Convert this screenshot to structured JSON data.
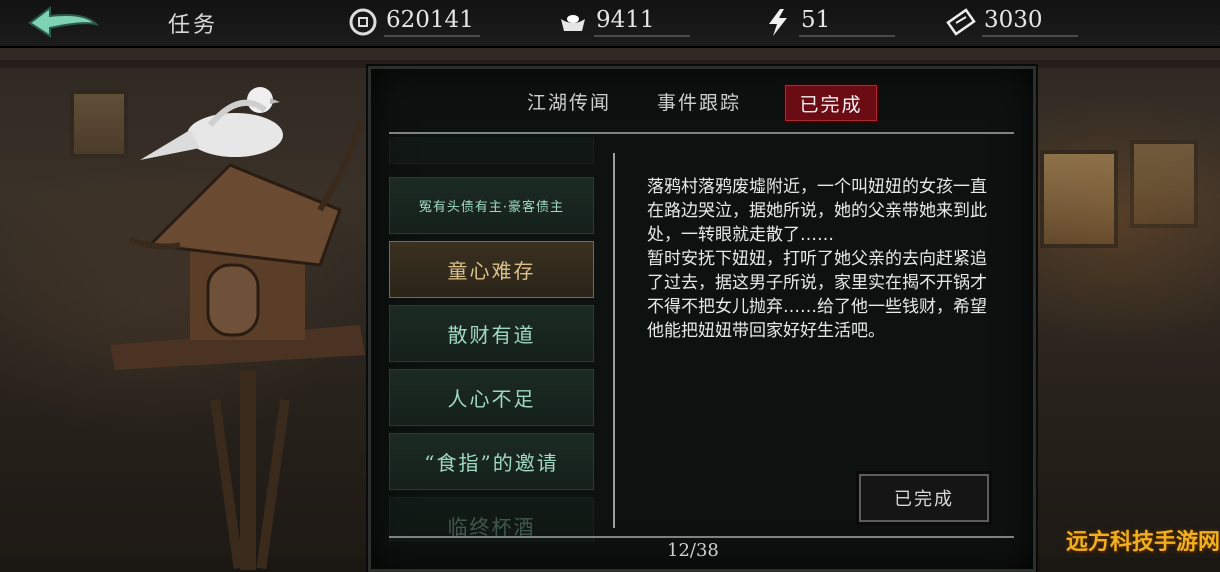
{
  "header": {
    "title": "任务",
    "resources": [
      {
        "icon": "coin-icon",
        "value": "620141"
      },
      {
        "icon": "silver-ingot-icon",
        "value": "9411"
      },
      {
        "icon": "lightning-icon",
        "value": "51"
      },
      {
        "icon": "ticket-icon",
        "value": "3030"
      }
    ]
  },
  "tabs": [
    {
      "label": "江湖传闻"
    },
    {
      "label": "事件跟踪"
    },
    {
      "label": "已完成",
      "active": true
    }
  ],
  "quests": [
    {
      "label": "冤有头债有主·豪客债主"
    },
    {
      "label": "童心难存",
      "selected": true
    },
    {
      "label": "散财有道"
    },
    {
      "label": "人心不足"
    },
    {
      "label": "“食指”的邀请"
    },
    {
      "label": "临终杯酒"
    }
  ],
  "detail": {
    "text": "落鸦村落鸦废墟附近，一个叫妞妞的女孩一直在路边哭泣，据她所说，她的父亲带她来到此处，一转眼就走散了……\n暂时安抚下妞妞，打听了她父亲的去向赶紧追了过去，据这男子所说，家里实在揭不开锅才不得不把女儿抛弃……给了他一些钱财，希望他能把妞妞带回家好好生活吧。",
    "status_button": "已完成"
  },
  "pager": "12/38",
  "watermark": "远方科技手游网",
  "colors": {
    "active_tab": "#6b0c14",
    "quest_text": "#9fd9c0",
    "selected_quest": "#d9c08a"
  }
}
